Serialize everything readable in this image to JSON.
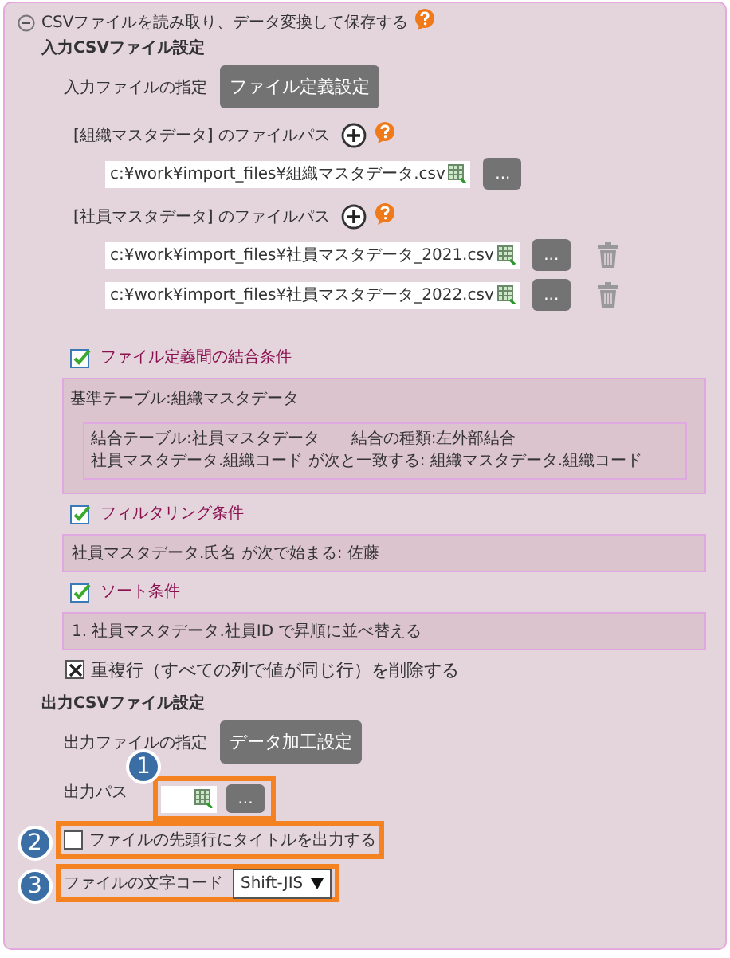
{
  "section": {
    "title": "CSVファイルを読み取り、データ変換して保存する",
    "expanded": true
  },
  "input_settings": {
    "heading": "入力CSVファイル設定",
    "spec_label": "入力ファイルの指定",
    "spec_button": "ファイル定義設定",
    "file_groups": [
      {
        "label": "[組織マスタデータ] のファイルパス",
        "paths": [
          {
            "value": "c:¥work¥import_files¥組織マスタデータ.csv",
            "browse": "...",
            "deletable": false
          }
        ]
      },
      {
        "label": "[社員マスタデータ] のファイルパス",
        "paths": [
          {
            "value": "c:¥work¥import_files¥社員マスタデータ_2021.csv",
            "browse": "...",
            "deletable": true
          },
          {
            "value": "c:¥work¥import_files¥社員マスタデータ_2022.csv",
            "browse": "...",
            "deletable": true
          }
        ]
      }
    ]
  },
  "join": {
    "title": "ファイル定義間の結合条件",
    "checked": true,
    "base": "基準テーブル:組織マスタデータ",
    "joins": [
      {
        "table": "結合テーブル:社員マスタデータ",
        "type": "結合の種類:左外部結合",
        "condition": "社員マスタデータ.組織コード が次と一致する: 組織マスタデータ.組織コード"
      }
    ]
  },
  "filter": {
    "title": "フィルタリング条件",
    "checked": true,
    "text": "社員マスタデータ.氏名 が次で始まる: 佐藤"
  },
  "sort": {
    "title": "ソート条件",
    "checked": true,
    "items": [
      "1. 社員マスタデータ.社員ID で昇順に並べ替える"
    ]
  },
  "dedupe": {
    "label": "重複行（すべての列で値が同じ行）を削除する",
    "checked": true
  },
  "output_settings": {
    "heading": "出力CSVファイル設定",
    "spec_label": "出力ファイルの指定",
    "spec_button": "データ加工設定",
    "path": {
      "label": "出力パス",
      "browse": "...",
      "callout": "1"
    },
    "title_row": {
      "label": "ファイルの先頭行にタイトルを出力する",
      "checked": false,
      "callout": "2"
    },
    "encoding": {
      "label": "ファイルの文字コード",
      "value": "Shift-JIS",
      "callout": "3"
    }
  }
}
